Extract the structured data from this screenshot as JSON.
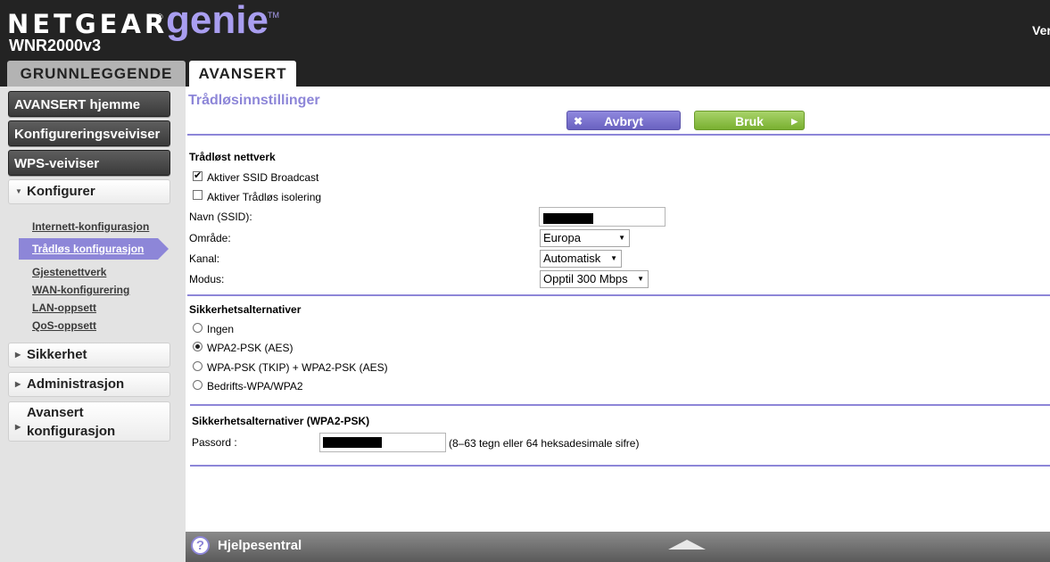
{
  "brand": {
    "netgear": "NETGEAR",
    "reg": "®",
    "genie": "genie",
    "tm": "TM",
    "model": "WNR2000v3",
    "version_partial": "Ver"
  },
  "tabs": {
    "basic": "GRUNNLEGGENDE",
    "advanced": "AVANSERT"
  },
  "sidebar": {
    "buttons": [
      "AVANSERT hjemme",
      "Konfigureringsveiviser",
      "WPS-veiviser"
    ],
    "configure": "Konfigurer",
    "sub_items": [
      "Internett-konfigurasjon",
      "Trådløs konfigurasjon",
      "Gjestenettverk",
      "WAN-konfigurering",
      "LAN-oppsett",
      "QoS-oppsett"
    ],
    "security": "Sikkerhet",
    "admin": "Administrasjon",
    "advanced_setup_line1": "Avansert",
    "advanced_setup_line2": "konfigurasjon"
  },
  "page": {
    "title": "Trådløsinnstillinger",
    "cancel": "Avbryt",
    "apply": "Bruk"
  },
  "wireless": {
    "section": "Trådløst nettverk",
    "ssid_broadcast": "Aktiver SSID Broadcast",
    "ssid_broadcast_checked": true,
    "isolation": "Aktiver Trådløs isolering",
    "isolation_checked": false,
    "name_label": "Navn (SSID):",
    "region_label": "Område:",
    "region_value": "Europa",
    "channel_label": "Kanal:",
    "channel_value": "Automatisk",
    "mode_label": "Modus:",
    "mode_value": "Opptil 300 Mbps"
  },
  "security": {
    "section": "Sikkerhetsalternativer",
    "options": [
      "Ingen",
      "WPA2-PSK (AES)",
      "WPA-PSK (TKIP) + WPA2-PSK (AES)",
      "Bedrifts-WPA/WPA2"
    ],
    "selected": "WPA2-PSK (AES)",
    "psk_section": "Sikkerhetsalternativer (WPA2-PSK)",
    "pass_label": "Passord :",
    "pass_hint": "(8–63 tegn eller 64 heksadesimale sifre)"
  },
  "footer": {
    "help": "Hjelpesentral"
  },
  "colors": {
    "accent": "#8d86d8",
    "apply": "#79b030",
    "header": "#232323"
  }
}
